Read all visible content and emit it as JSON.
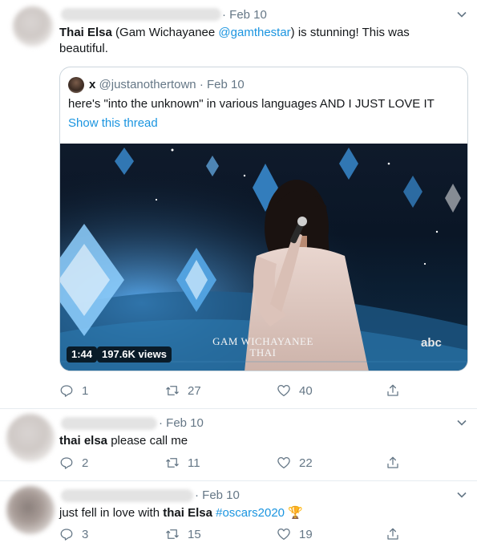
{
  "tweets": [
    {
      "date": "· Feb 10",
      "name_bold": "Thai Elsa",
      "text_before": " (Gam Wichayanee ",
      "mention": "@gamthestar",
      "text_after": ") is stunning! This was beautiful.",
      "replies": "1",
      "retweets": "27",
      "likes": "40"
    },
    {
      "date": "· Feb 10",
      "name_bold": "thai elsa",
      "text_after": " please call me",
      "replies": "2",
      "retweets": "11",
      "likes": "22"
    },
    {
      "date": "· Feb 10",
      "text_before": "just fell in love with ",
      "name_bold": "thai Elsa",
      "hashtag": "#oscars2020",
      "emoji": "🏆",
      "replies": "3",
      "retweets": "15",
      "likes": "19"
    }
  ],
  "quote": {
    "name": "x",
    "handle": "@justanothertown",
    "date": "· Feb 10",
    "text": "here's \"into the unknown\" in various languages AND I JUST LOVE IT",
    "show_thread": "Show this thread",
    "video": {
      "duration": "1:44",
      "views": "197.6K views",
      "caption_line1": "GAM WICHAYANEE",
      "caption_line2": "THAI",
      "network_logo": "abc"
    }
  },
  "colors": {
    "link": "#1b95e0",
    "muted": "#657786",
    "border": "#e6ecf0"
  }
}
